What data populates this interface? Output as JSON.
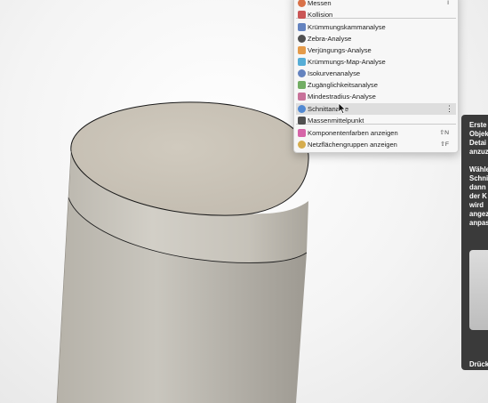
{
  "menu": {
    "items": [
      {
        "label": "Messen",
        "shortcut": "I",
        "icon": "ruler-icon",
        "icon_color": "#d35a2a"
      },
      {
        "label": "Kollision",
        "shortcut": "",
        "icon": "interference-icon",
        "icon_color": "#c23a3a"
      },
      {
        "label": "Krümmungskammanalyse",
        "shortcut": "",
        "icon": "curvature-comb-icon",
        "icon_color": "#4a6fb5"
      },
      {
        "label": "Zebra-Analyse",
        "shortcut": "",
        "icon": "zebra-icon",
        "icon_color": "#333333"
      },
      {
        "label": "Verjüngungs-Analyse",
        "shortcut": "",
        "icon": "draft-analysis-icon",
        "icon_color": "#e08a2a"
      },
      {
        "label": "Krümmungs-Map-Analyse",
        "shortcut": "",
        "icon": "curvature-map-icon",
        "icon_color": "#3aa0d0"
      },
      {
        "label": "Isokurvenanalyse",
        "shortcut": "",
        "icon": "isocurve-icon",
        "icon_color": "#4a6fb5"
      },
      {
        "label": "Zugänglichkeitsanalyse",
        "shortcut": "",
        "icon": "accessibility-icon",
        "icon_color": "#5aa04a"
      },
      {
        "label": "Mindestradius-Analyse",
        "shortcut": "",
        "icon": "min-radius-icon",
        "icon_color": "#c05a8a"
      },
      {
        "label": "Schnittanalyse",
        "shortcut": "",
        "icon": "section-analysis-icon",
        "icon_color": "#3a7ad0"
      },
      {
        "label": "Massenmittelpunkt",
        "shortcut": "",
        "icon": "center-of-mass-icon",
        "icon_color": "#333333"
      },
      {
        "label": "Komponentenfarben anzeigen",
        "shortcut": "⇧N",
        "icon": "component-colors-icon",
        "icon_color": "#d04a9a"
      },
      {
        "label": "Netzflächengruppen anzeigen",
        "shortcut": "⇧F",
        "icon": "mesh-face-groups-icon",
        "icon_color": "#d0a030"
      }
    ],
    "highlighted_index": 9,
    "highlighted_partial_label": "Schnittana",
    "highlighted_partial_label_tail": "e"
  },
  "tooltip": {
    "lines": [
      "Erste",
      "Objek",
      "Detai",
      "anzuz",
      "",
      "Wähle",
      "Schni",
      "dann",
      "der K",
      "wird",
      "angez",
      "anpas"
    ],
    "footer": "Drück"
  },
  "model": {
    "body_color": "#c8c4bb",
    "top_face_color": "#c9c2b6"
  }
}
